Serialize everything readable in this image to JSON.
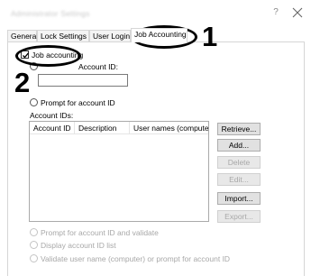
{
  "window": {
    "title": "Administrator Settings",
    "help_glyph": "?"
  },
  "tabs": [
    {
      "label": "General"
    },
    {
      "label": "Lock Settings"
    },
    {
      "label": "User Login"
    },
    {
      "label": "Job Accounting",
      "active": true
    }
  ],
  "job_accounting": {
    "label": "Job accounting",
    "checked": true
  },
  "account_id": {
    "label": "Account ID:",
    "value": ""
  },
  "prompt_for_account_id": {
    "label": "Prompt for account ID"
  },
  "account_ids": {
    "label": "Account IDs:",
    "columns": [
      "Account ID",
      "Description",
      "User names (computer)"
    ],
    "rows": []
  },
  "buttons": [
    {
      "label": "Retrieve...",
      "enabled": true
    },
    {
      "label": "Add...",
      "enabled": true
    },
    {
      "label": "Delete",
      "enabled": false
    },
    {
      "label": "Edit...",
      "enabled": false
    },
    {
      "label": "Import...",
      "enabled": true
    },
    {
      "label": "Export...",
      "enabled": false
    }
  ],
  "bottom_options": [
    {
      "label": "Prompt for account ID and validate",
      "enabled": false
    },
    {
      "label": "Display account ID list",
      "enabled": false
    },
    {
      "label": "Validate user name (computer) or prompt for account ID",
      "enabled": false
    }
  ],
  "callouts": [
    {
      "number": "1"
    },
    {
      "number": "2"
    }
  ],
  "colors": {
    "callout": "#000000",
    "disabled_text": "#a8a8a8",
    "button_face": "#e1e1e1"
  }
}
